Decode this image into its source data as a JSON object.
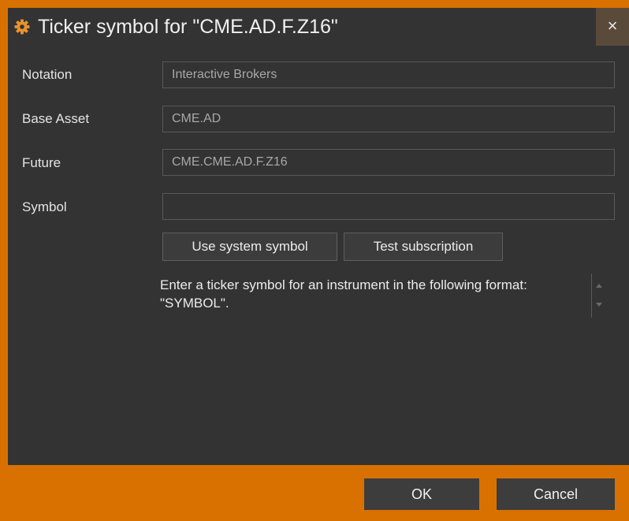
{
  "window": {
    "title": "Ticker symbol for \"CME.AD.F.Z16\"",
    "close_label": "×"
  },
  "form": {
    "notation": {
      "label": "Notation",
      "value": "Interactive Brokers"
    },
    "base_asset": {
      "label": "Base Asset",
      "value": "CME.AD"
    },
    "future": {
      "label": "Future",
      "value": "CME.CME.AD.F.Z16"
    },
    "symbol": {
      "label": "Symbol",
      "value": ""
    }
  },
  "actions": {
    "use_system_symbol": "Use system symbol",
    "test_subscription": "Test subscription"
  },
  "hint": "Enter a ticker symbol for an instrument in the following format: \"SYMBOL\".",
  "footer": {
    "ok": "OK",
    "cancel": "Cancel"
  },
  "colors": {
    "accent": "#d97100",
    "panel": "#333333",
    "gear_icon": "#e8922e"
  },
  "icons": {
    "title": "gear-icon",
    "close": "close-icon",
    "scroll_up": "scroll-up-arrow-icon",
    "scroll_down": "scroll-down-arrow-icon"
  }
}
